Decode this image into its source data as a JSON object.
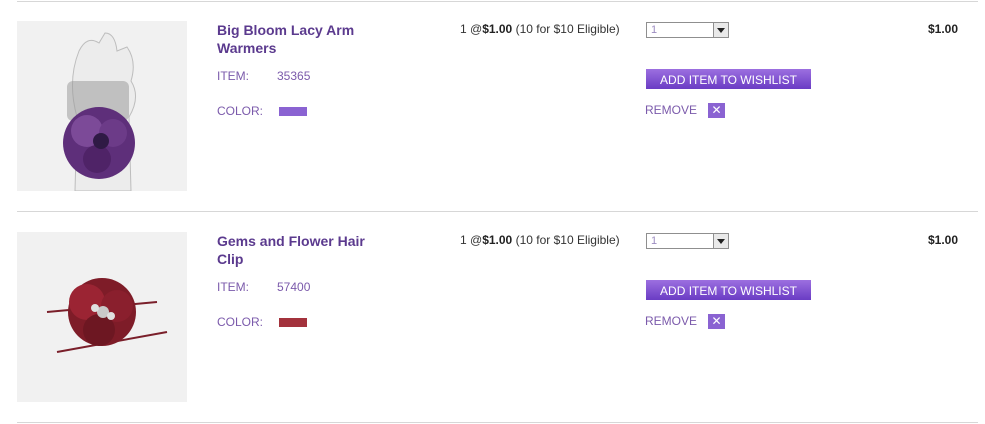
{
  "cart": {
    "items": [
      {
        "name": "Big Bloom Lacy Arm Warmers",
        "item_label": "ITEM:",
        "item_number": "35365",
        "color_label": "COLOR:",
        "color": "#8a63d2",
        "quantity_prefix": "1 @",
        "unit_price": "$1.00",
        "deal": "(10 for $10 Eligible)",
        "quantity_selected": "1",
        "wishlist_label": "ADD ITEM TO WISHLIST",
        "remove_label": "REMOVE",
        "remove_icon": "✕",
        "line_total": "$1.00",
        "image_icon": "arm-warmer-product-image"
      },
      {
        "name": "Gems and Flower Hair Clip",
        "item_label": "ITEM:",
        "item_number": "57400",
        "color_label": "COLOR:",
        "color": "#a3323c",
        "quantity_prefix": "1 @",
        "unit_price": "$1.00",
        "deal": "(10 for $10 Eligible)",
        "quantity_selected": "1",
        "wishlist_label": "ADD ITEM TO WISHLIST",
        "remove_label": "REMOVE",
        "remove_icon": "✕",
        "line_total": "$1.00",
        "image_icon": "hair-clip-product-image"
      }
    ]
  }
}
